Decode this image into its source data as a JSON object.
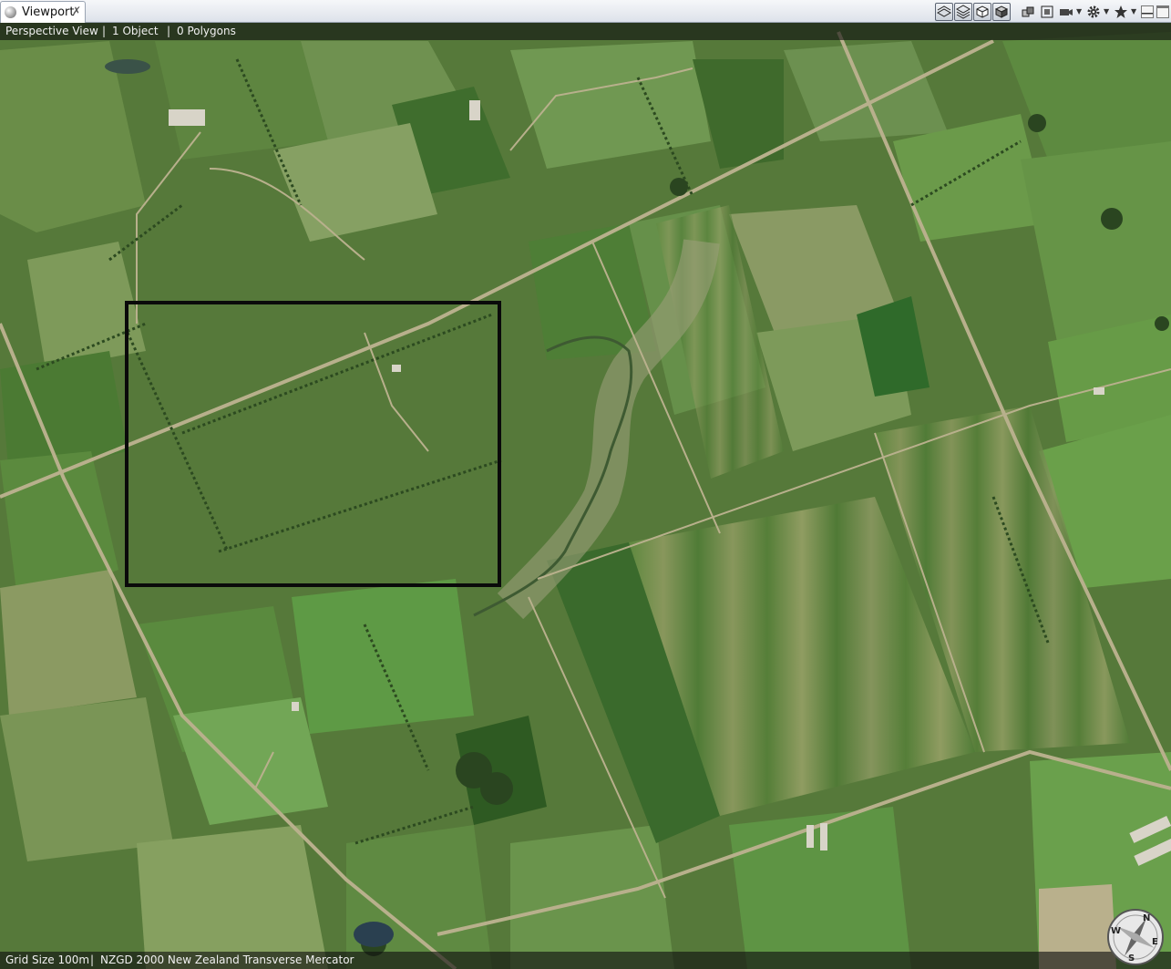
{
  "tab": {
    "icon": "sphere-icon",
    "title": "Viewport",
    "close": "✗"
  },
  "toolbar": {
    "buttons": [
      "layers-flat-icon",
      "layers-stack-icon",
      "cube-icon",
      "cube-shaded-icon",
      "cube-objects-icon",
      "frame-icon",
      "camera-icon",
      "gear-icon",
      "star-icon"
    ],
    "window_controls": [
      "minimize-icon",
      "maximize-icon"
    ]
  },
  "infobar": {
    "view": "Perspective View",
    "sep1": "|",
    "objects": "1 Object",
    "sep2": "|",
    "polygons": "0 Polygons"
  },
  "statusbar": {
    "grid": "Grid Size 100m",
    "sep": "|",
    "projection": "NZGD 2000 New Zealand Transverse Mercator"
  },
  "compass": {
    "n": "N",
    "e": "E",
    "s": "S",
    "w": "W"
  },
  "colors": {
    "selection_box": "#0a0a0a",
    "field_dark": "#3f6a2c",
    "field_light": "#7ea05a",
    "road": "#b8b08c"
  }
}
